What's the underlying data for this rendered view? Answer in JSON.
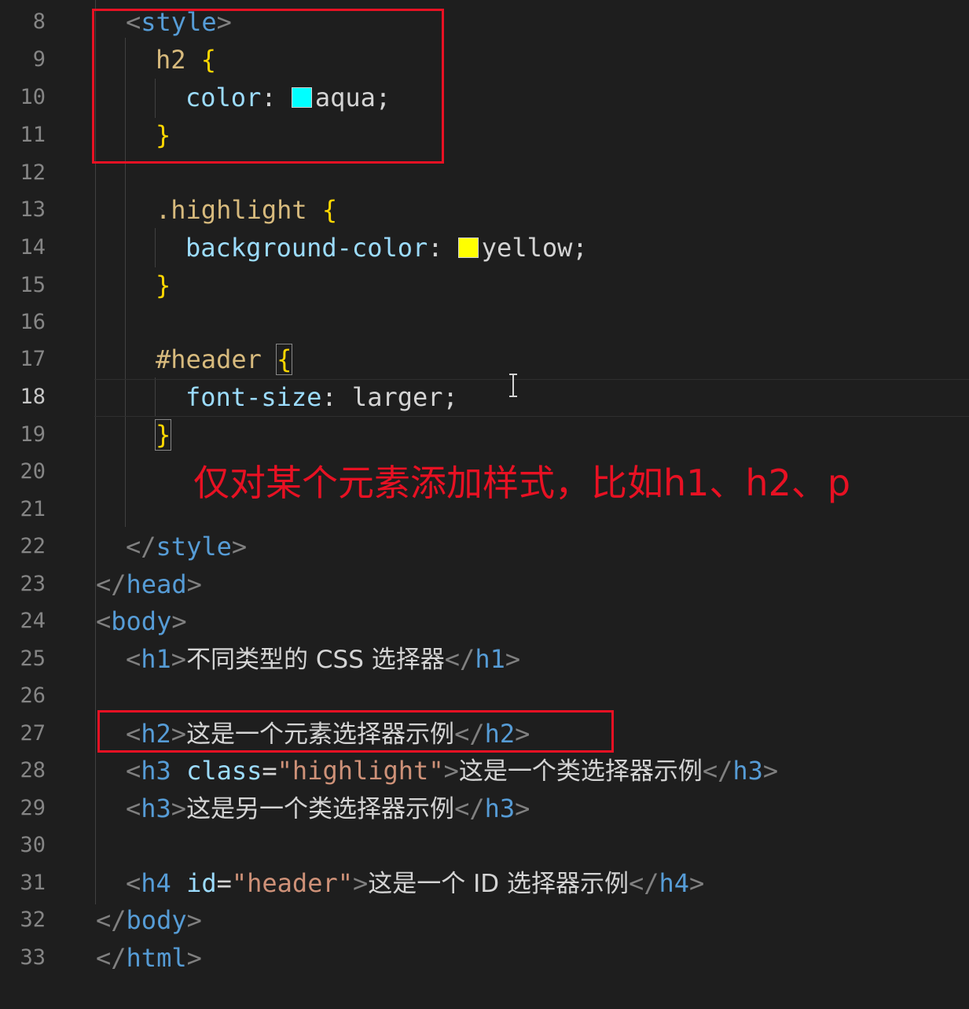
{
  "editor": {
    "language": "html",
    "active_line": "18",
    "colors": {
      "background": "#1e1e1e",
      "annotation": "#e81123",
      "aqua_swatch": "#00ffff",
      "yellow_swatch": "#ffff00"
    },
    "lines": [
      {
        "n": "8",
        "tokens": [
          "<",
          "style",
          ">"
        ]
      },
      {
        "n": "9",
        "tokens": [
          "h2",
          "{"
        ]
      },
      {
        "n": "10",
        "tokens": [
          "color",
          ":",
          "aqua",
          ";"
        ]
      },
      {
        "n": "11",
        "tokens": [
          "}"
        ]
      },
      {
        "n": "12",
        "tokens": []
      },
      {
        "n": "13",
        "tokens": [
          ".highlight",
          "{"
        ]
      },
      {
        "n": "14",
        "tokens": [
          "background-color",
          ":",
          "yellow",
          ";"
        ]
      },
      {
        "n": "15",
        "tokens": [
          "}"
        ]
      },
      {
        "n": "16",
        "tokens": []
      },
      {
        "n": "17",
        "tokens": [
          "#header",
          "{"
        ]
      },
      {
        "n": "18",
        "tokens": [
          "font-size",
          ":",
          "larger",
          ";"
        ]
      },
      {
        "n": "19",
        "tokens": [
          "}"
        ]
      },
      {
        "n": "20",
        "tokens": []
      },
      {
        "n": "21",
        "tokens": []
      },
      {
        "n": "22",
        "tokens": [
          "</",
          "style",
          ">"
        ]
      },
      {
        "n": "23",
        "tokens": [
          "</",
          "head",
          ">"
        ]
      },
      {
        "n": "24",
        "tokens": [
          "<",
          "body",
          ">"
        ]
      },
      {
        "n": "25",
        "tokens": [
          "<",
          "h1",
          ">",
          "不同类型的 CSS 选择器",
          "</",
          "h1",
          ">"
        ]
      },
      {
        "n": "26",
        "tokens": []
      },
      {
        "n": "27",
        "tokens": [
          "<",
          "h2",
          ">",
          "这是一个元素选择器示例",
          "</",
          "h2",
          ">"
        ]
      },
      {
        "n": "28",
        "tokens": [
          "<",
          "h3",
          "class",
          "=",
          "\"highlight\"",
          ">",
          "这是一个类选择器示例",
          "</",
          "h3",
          ">"
        ]
      },
      {
        "n": "29",
        "tokens": [
          "<",
          "h3",
          ">",
          "这是另一个类选择器示例",
          "</",
          "h3",
          ">"
        ]
      },
      {
        "n": "30",
        "tokens": []
      },
      {
        "n": "31",
        "tokens": [
          "<",
          "h4",
          "id",
          "=",
          "\"header\"",
          ">",
          "这是一个 ID 选择器示例",
          "</",
          "h4",
          ">"
        ]
      },
      {
        "n": "32",
        "tokens": [
          "</",
          "body",
          ">"
        ]
      },
      {
        "n": "33",
        "tokens": [
          "</",
          "html",
          ">"
        ]
      }
    ]
  },
  "annotation": {
    "text": "仅对某个元素添加样式，比如h1、h2、p"
  }
}
